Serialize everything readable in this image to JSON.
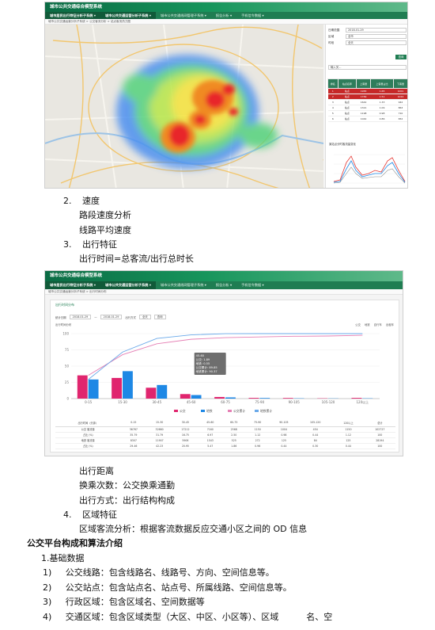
{
  "shot1": {
    "title": "城市公共交通综合模型系统",
    "nav": [
      "城市居民出行特征分析子系统 ▾",
      "城市公共交通运营分析子系统 ▾",
      "城市公共交通线网管理子系统 ▾",
      "报告分析 ▾",
      "手机信令数据 ▾"
    ],
    "breadcrumb": "城市公共交通运营分析子系统 > 公交客流分析 > 站点客流热力图",
    "panel": {
      "date_label": "日期范围",
      "date_value": "2018-01-29",
      "area_label": "区域",
      "area_value": "全市",
      "time_label": "时段",
      "time_value": "全天",
      "query": "查询",
      "search_placeholder": "输入关...",
      "headers": [
        "排名",
        "站点名称",
        "上客量",
        "上客量占比",
        "下客量"
      ],
      "rows": [
        [
          "1",
          "站点",
          "1983",
          "1.65",
          "1001"
        ],
        [
          "2",
          "站点",
          "1769",
          "1.51",
          "1024"
        ],
        [
          "3",
          "站点",
          "1642",
          "1.33",
          "942"
        ],
        [
          "4",
          "站点",
          "1321",
          "1.09",
          "863"
        ],
        [
          "5",
          "站点",
          "1198",
          "0.98",
          "710"
        ],
        [
          "6",
          "站点",
          "1042",
          "0.86",
          "652"
        ]
      ],
      "mini_chart_title": "某站点分时客流量变化"
    }
  },
  "text_block_1": [
    {
      "num": "2.",
      "text": "速度"
    },
    {
      "num": "",
      "text": "路段速度分析"
    },
    {
      "num": "",
      "text": "线路平均速度"
    },
    {
      "num": "3.",
      "text": "出行特征"
    },
    {
      "num": "",
      "text": "出行时间=总客流/出行总时长"
    }
  ],
  "shot2": {
    "title": "城市公共交通综合模型系统",
    "nav": [
      "城市居民出行特征分析子系统 ▾",
      "城市公共交通运营分析子系统 ▾",
      "城市公共交通线网管理子系统 ▾",
      "报告分析 ▾",
      "手机信令数据 ▾"
    ],
    "breadcrumb": "城市公共交通运营分析子系统 > 出行时间分布",
    "card_title": "出行时间分布",
    "filter_date_label": "统计日期",
    "filter_from": "2018-01-29",
    "filter_to": "2018-01-29",
    "filter_type_label": "出行方式",
    "filter_type": "全天",
    "filter_btn": "查询",
    "sub_label": "出行时间分布",
    "legend_top": [
      "公交",
      "地铁",
      "自行车",
      "出租车"
    ],
    "legend_bottom": [
      "公交",
      "地铁",
      "公交累计",
      "地铁累计"
    ],
    "tooltip": [
      "45-60",
      "公交: 1.89",
      "地铁: 0.55",
      "公交累计: 89.85",
      "地铁累计: 90.37"
    ],
    "table_headers": [
      "出行时间（分钟）",
      "0-15",
      "15-30",
      "30-45",
      "45-60",
      "60-75",
      "75-90",
      "90-105",
      "105-120",
      "120以上",
      "总计"
    ],
    "table_rows": [
      [
        "公交 客流量",
        "36767",
        "32660",
        "17212",
        "7160",
        "2568",
        "1150",
        "1004",
        "454",
        "1150",
        "102727"
      ],
      [
        "占比 (%)",
        "35.79",
        "31.79",
        "16.75",
        "6.97",
        "2.50",
        "1.12",
        "0.98",
        "0.44",
        "1.12",
        "100"
      ],
      [
        "地铁 客流量",
        "8307",
        "11907",
        "5906",
        "1543",
        "525",
        "272",
        "125",
        "84",
        "125",
        "28194"
      ],
      [
        "占比 (%)",
        "29.46",
        "42.23",
        "20.95",
        "5.47",
        "1.86",
        "0.96",
        "0.44",
        "0.30",
        "0.44",
        "100"
      ]
    ]
  },
  "text_block_2": [
    {
      "num": "",
      "text": "出行距离"
    },
    {
      "num": "",
      "text": "换乘次数：公交换乘通勤"
    },
    {
      "num": "",
      "text": "出行方式：出行结构构成"
    },
    {
      "num": "4.",
      "text": "区域特征"
    },
    {
      "num": "",
      "text": "区域客流分析：根据客流数据反应交通小区之间的 OD 信息"
    }
  ],
  "section_title": "公交平台构成和算法介绍",
  "subsection": "1.基础数据",
  "items": [
    {
      "num": "1)",
      "text": "公交线路：包含线路名、线路号、方向、空间信息等。"
    },
    {
      "num": "2)",
      "text": "公交站点：包含站点名、站点号、所属线路、空间信息等。"
    },
    {
      "num": "3)",
      "text": "行政区域：包含区域名、空间数据等"
    },
    {
      "num": "4)",
      "text": "交通区域：包含区域类型（大区、中区、小区等）、区域          名、空"
    }
  ],
  "colors": {
    "brand": "#17955c",
    "bar_bus": "#e0256e",
    "bar_metro": "#1e88e5",
    "line_bus": "#e57fb4",
    "line_metro": "#6aa9e9"
  },
  "chart_data": {
    "type": "bar",
    "categories": [
      "0-15",
      "15-30",
      "30-45",
      "45-60",
      "60-75",
      "75-90",
      "90-105",
      "105-120",
      "120以上"
    ],
    "series": [
      {
        "name": "公交",
        "values": [
          35.79,
          31.79,
          16.75,
          6.97,
          2.5,
          1.12,
          0.98,
          0.44,
          1.12
        ]
      },
      {
        "name": "地铁",
        "values": [
          29.46,
          42.23,
          20.95,
          5.47,
          1.86,
          0.96,
          0.44,
          0.3,
          0.44
        ]
      },
      {
        "name": "公交累计",
        "values": [
          35.79,
          67.58,
          84.33,
          91.3,
          93.8,
          94.92,
          95.9,
          96.34,
          97.46
        ]
      },
      {
        "name": "地铁累计",
        "values": [
          29.46,
          71.69,
          92.64,
          98.11,
          99.97,
          100.9,
          101.3,
          101.6,
          102.1
        ]
      }
    ],
    "ylim": [
      0,
      100
    ]
  }
}
